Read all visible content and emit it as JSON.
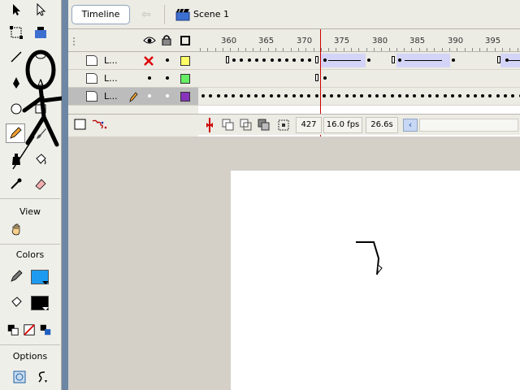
{
  "topbar": {
    "timeline_label": "Timeline",
    "back_arrow": "⇦",
    "scene_label": "Scene 1"
  },
  "tools": {
    "view_label": "View",
    "colors_label": "Colors",
    "options_label": "Options",
    "stroke_color": "#1e9bf0",
    "fill_color": "#000000",
    "items": [
      "selection-tool",
      "subselection-tool",
      "free-transform-tool",
      "fill-transform-tool",
      "line-tool",
      "lasso-tool",
      "pen-tool",
      "text-tool",
      "oval-tool",
      "rectangle-tool",
      "pencil-tool",
      "brush-tool",
      "ink-bottle-tool",
      "paint-bucket-tool",
      "eyedropper-tool",
      "eraser-tool",
      "hand-tool",
      "zoom-tool"
    ]
  },
  "layers": [
    {
      "name": "L...",
      "hidden": true,
      "color": "#ffff66"
    },
    {
      "name": "L...",
      "hidden": false,
      "color": "#66ee66"
    },
    {
      "name": "L...",
      "hidden": false,
      "color": "#8833bb",
      "active": true
    }
  ],
  "ruler": [
    "360",
    "365",
    "370",
    "375",
    "380",
    "385",
    "390",
    "395"
  ],
  "status": {
    "frame": "427",
    "fps": "16.0 fps",
    "time": "26.6s"
  }
}
